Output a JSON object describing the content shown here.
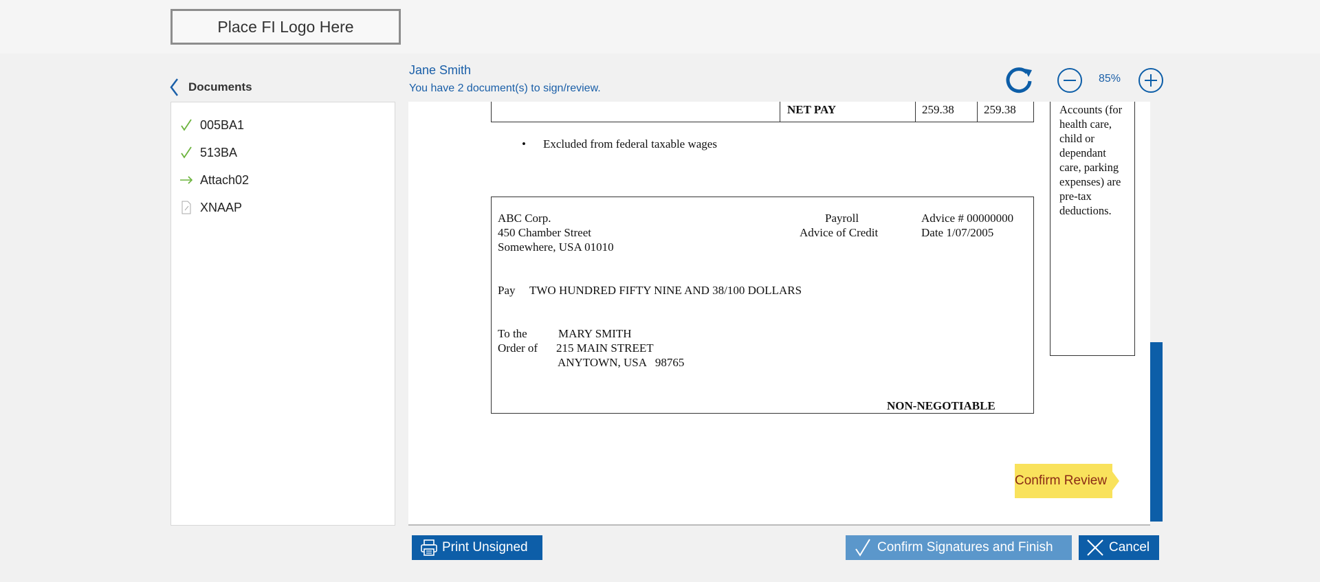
{
  "header": {
    "logo_text": "Place FI Logo Here"
  },
  "nav": {
    "back_label": "Documents"
  },
  "user": {
    "name": "Jane Smith",
    "message": "You have 2 document(s) to sign/review."
  },
  "zoom": {
    "level": "85%"
  },
  "documents": [
    {
      "label": "005BA1",
      "status": "signed",
      "icon": "check-icon"
    },
    {
      "label": "513BA",
      "status": "signed",
      "icon": "check-icon"
    },
    {
      "label": "Attach02",
      "status": "current",
      "icon": "arrow-right-icon"
    },
    {
      "label": "XNAAP",
      "status": "pending",
      "icon": "document-icon"
    }
  ],
  "document": {
    "pay_table": {
      "label": "NET PAY",
      "current": "259.38",
      "ytd": "259.38"
    },
    "bullet_note": "Excluded from federal taxable wages",
    "sidenote": "Accounts (for health care, child or dependant care, parking expenses) are pre-tax deductions.",
    "check": {
      "company": "ABC Corp.",
      "address1": "450 Chamber Street",
      "address2": "Somewhere, USA 01010",
      "type1": "Payroll",
      "type2": "Advice of Credit",
      "advice": "Advice # 00000000",
      "date": "Date 1/07/2005",
      "pay_label": "Pay",
      "pay_amount": "TWO HUNDRED FIFTY NINE AND 38/100 DOLLARS",
      "to_the": "To the",
      "order_of": "Order of",
      "payee_name": "MARY SMITH",
      "payee_street": "215 MAIN STREET",
      "payee_city": "ANYTOWN, USA   98765",
      "non_negotiable": "NON-NEGOTIABLE"
    }
  },
  "confirm_review": "Confirm Review",
  "buttons": {
    "print": "Print Unsigned",
    "confirm": "Confirm Signatures and Finish",
    "cancel": "Cancel"
  },
  "colors": {
    "primary": "#0d5ea8",
    "confirm": "#5b97cb",
    "highlight": "#f9e25c",
    "check": "#6bb33c"
  }
}
